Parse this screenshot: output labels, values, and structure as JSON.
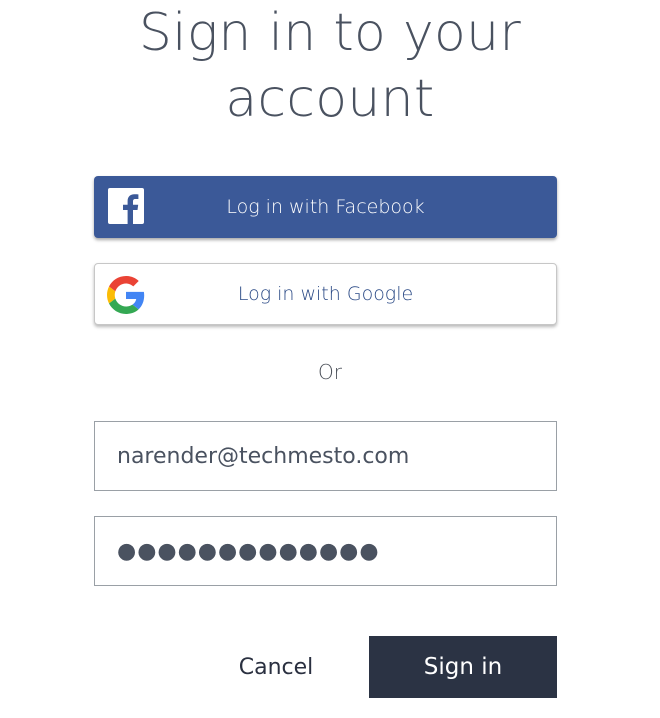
{
  "title": {
    "line1": "Sign in to your",
    "line2": "account"
  },
  "social": {
    "facebook": {
      "label": "Log in with Facebook",
      "icon": "facebook-icon",
      "color": "#3b5998"
    },
    "google": {
      "label": "Log in with Google",
      "icon": "google-icon"
    }
  },
  "divider": {
    "text": "Or"
  },
  "form": {
    "email_value": "narender@techmesto.com",
    "password_value": "●●●●●●●●●●●●●"
  },
  "actions": {
    "cancel_label": "Cancel",
    "signin_label": "Sign in",
    "signin_color": "#2b3344"
  }
}
